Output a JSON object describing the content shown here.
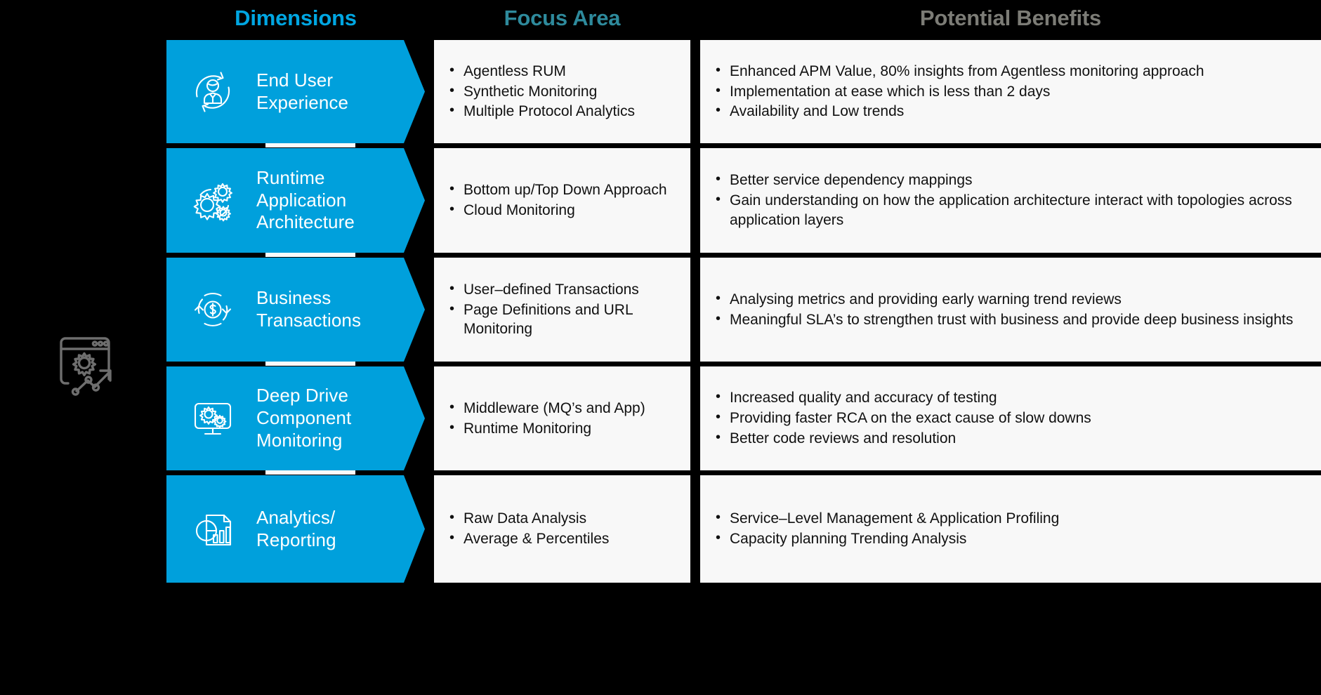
{
  "headers": {
    "dimensions": "Dimensions",
    "focus_area": "Focus Area",
    "potential_benefits": "Potential Benefits"
  },
  "colors": {
    "background": "#000000",
    "chevron_blue": "#00A0DC",
    "header_dimensions": "#00A6E2",
    "header_focus": "#2E8A9C",
    "header_benefits": "#7C7C76",
    "card_background": "#F8F8F8",
    "card_text": "#111111",
    "left_icon": "#6E6E6E"
  },
  "left_panel": {
    "icon": "browser-gear-trend-icon"
  },
  "rows": [
    {
      "icon": "user-cycle-icon",
      "dimension": "End User\nExperience",
      "focus_area": [
        "Agentless RUM",
        "Synthetic Monitoring",
        "Multiple Protocol Analytics"
      ],
      "potential_benefits": [
        "Enhanced APM Value, 80% insights from Agentless monitoring approach",
        "Implementation at ease which is less than 2 days",
        "Availability and Low trends"
      ]
    },
    {
      "icon": "gears-icon",
      "dimension": "Runtime\nApplication\nArchitecture",
      "focus_area": [
        "Bottom up/Top Down Approach",
        "Cloud Monitoring"
      ],
      "potential_benefits": [
        "Better service dependency mappings",
        "Gain understanding on how the application architecture interact with topologies across application layers"
      ]
    },
    {
      "icon": "dollar-cycle-icon",
      "dimension": "Business\nTransactions",
      "focus_area": [
        "User–defined Transactions",
        "Page Definitions and URL Monitoring"
      ],
      "potential_benefits": [
        "Analysing metrics and providing early warning trend reviews",
        "Meaningful SLA’s to strengthen trust with business and provide deep business insights"
      ]
    },
    {
      "icon": "monitor-gears-icon",
      "dimension": "Deep Drive\nComponent\nMonitoring",
      "focus_area": [
        "Middleware (MQ’s and App)",
        "Runtime Monitoring"
      ],
      "potential_benefits": [
        "Increased quality and accuracy of testing",
        "Providing faster RCA on the exact cause of slow downs",
        "Better code reviews and resolution"
      ]
    },
    {
      "icon": "report-chart-icon",
      "dimension": "Analytics/\nReporting",
      "focus_area": [
        "Raw Data Analysis",
        "Average & Percentiles"
      ],
      "potential_benefits": [
        "Service–Level Management & Application Profiling",
        "Capacity planning Trending Analysis"
      ]
    }
  ]
}
